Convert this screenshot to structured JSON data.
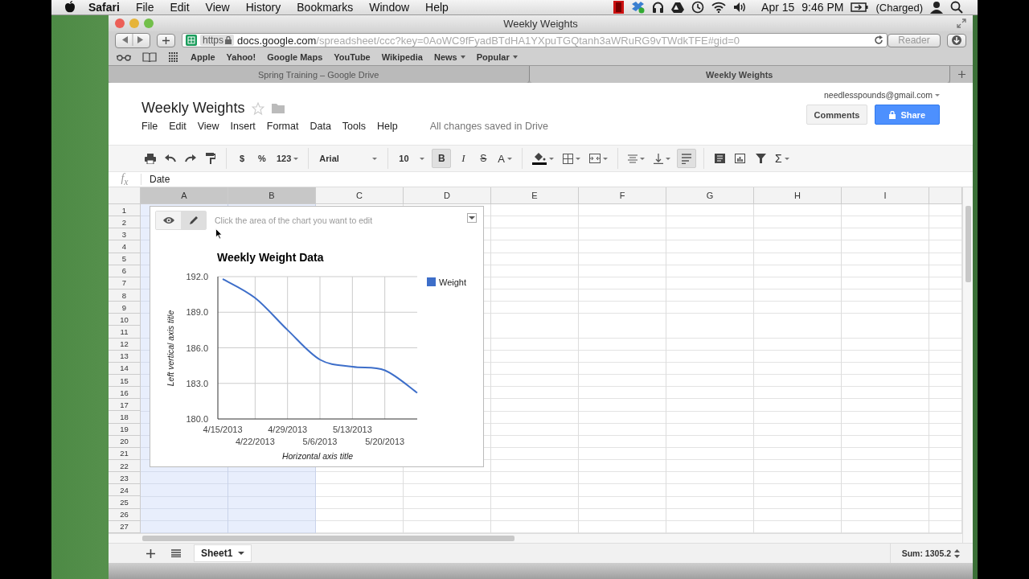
{
  "menu_bar": {
    "app": "Safari",
    "items": [
      "File",
      "Edit",
      "View",
      "History",
      "Bookmarks",
      "Window",
      "Help"
    ],
    "date": "Apr 15",
    "time": "9:46 PM",
    "battery": "(Charged)"
  },
  "window": {
    "title": "Weekly Weights"
  },
  "toolbar": {
    "url_scheme": "https",
    "url_host": "docs.google.com",
    "url_path": "/spreadsheet/ccc?key=0AoWC9fFyadBTdHA1YXpuTGQtanh3aWRuRG9vTWdkTFE#gid=0",
    "reader": "Reader"
  },
  "bookmarks": [
    {
      "label": "Apple",
      "kind": "link"
    },
    {
      "label": "Yahoo!",
      "kind": "link"
    },
    {
      "label": "Google Maps",
      "kind": "link"
    },
    {
      "label": "YouTube",
      "kind": "link"
    },
    {
      "label": "Wikipedia",
      "kind": "link"
    },
    {
      "label": "News",
      "kind": "menu"
    },
    {
      "label": "Popular",
      "kind": "menu"
    }
  ],
  "tabs": [
    {
      "label": "Spring Training – Google Drive",
      "selected": false
    },
    {
      "label": "Weekly Weights",
      "selected": true
    }
  ],
  "doc": {
    "title": "Weekly Weights",
    "account": "needlesspounds@gmail.com",
    "menus": [
      "File",
      "Edit",
      "View",
      "Insert",
      "Format",
      "Data",
      "Tools",
      "Help"
    ],
    "save_status": "All changes saved in Drive",
    "comments": "Comments",
    "share": "Share"
  },
  "format_bar": {
    "currency": "$",
    "percent": "%",
    "number_format": "123",
    "font": "Arial",
    "font_size": "10",
    "bold": "B",
    "bold_on": true,
    "italic": "I",
    "strike": "S",
    "text_color": "A",
    "functions": "Σ",
    "wrap_on": true
  },
  "formula_bar": {
    "fx": "f$_{x}$",
    "value": "Date"
  },
  "grid": {
    "columns": [
      {
        "label": "A",
        "selected": true
      },
      {
        "label": "B",
        "selected": true
      },
      {
        "label": "C",
        "selected": false
      },
      {
        "label": "D",
        "selected": false
      },
      {
        "label": "E",
        "selected": false
      },
      {
        "label": "F",
        "selected": false
      },
      {
        "label": "G",
        "selected": false
      },
      {
        "label": "H",
        "selected": false
      },
      {
        "label": "I",
        "selected": false
      }
    ],
    "rows": [
      "1",
      "2",
      "3",
      "4",
      "5",
      "6",
      "7",
      "8",
      "9",
      "10",
      "11",
      "12",
      "13",
      "14",
      "15",
      "16",
      "17",
      "18",
      "19",
      "20",
      "21",
      "22",
      "23",
      "24",
      "25",
      "26",
      "27"
    ]
  },
  "chart": {
    "hint": "Click the area of the chart you want to edit",
    "modes": [
      {
        "kind": "view",
        "selected": false
      },
      {
        "kind": "edit",
        "selected": true
      }
    ],
    "chart_data": {
      "type": "line",
      "grid": true,
      "title": "Weekly Weight Data",
      "xlabel": "Horizontal axis title",
      "ylabel": "Left vertical axis title",
      "categories": [
        "4/15/2013",
        "4/22/2013",
        "4/29/2013",
        "5/6/2013",
        "5/13/2013",
        "5/20/2013",
        null
      ],
      "ylim": [
        180,
        192
      ],
      "yticks": [
        {
          "value": 180,
          "label": "180.0"
        },
        {
          "value": 183,
          "label": "183.0"
        },
        {
          "value": 186,
          "label": "186.0"
        },
        {
          "value": 189,
          "label": "189.0"
        },
        {
          "value": 192,
          "label": "192.0"
        }
      ],
      "series": [
        {
          "name": "Weight",
          "color": "#3d6ec9",
          "values": [
            191.8,
            190.2,
            187.5,
            185.0,
            184.4,
            184.1,
            182.2
          ]
        }
      ]
    }
  },
  "sheets": [
    {
      "label": "Sheet1",
      "selected": true
    }
  ],
  "sum": "Sum: 1305.2"
}
